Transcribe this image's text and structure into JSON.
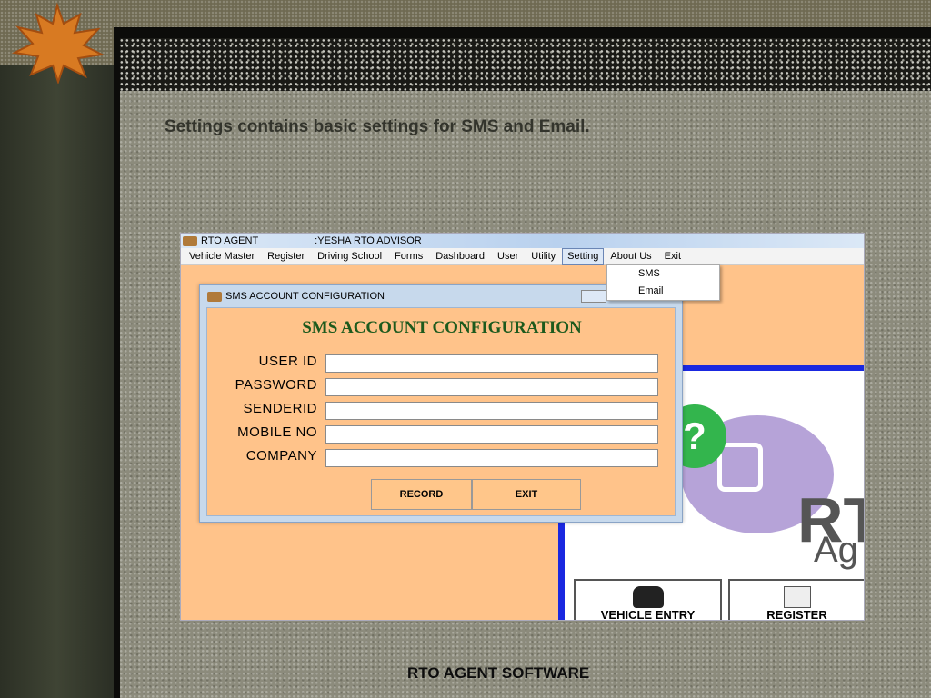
{
  "slide": {
    "heading": "Settings contains basic settings for SMS and Email.",
    "footer": "RTO  AGENT SOFTWARE"
  },
  "app": {
    "title": "RTO AGENT",
    "subtitle": ":YESHA RTO ADVISOR",
    "menu": [
      "Vehicle Master",
      "Register",
      "Driving School",
      "Forms",
      "Dashboard",
      "User",
      "Utility",
      "Setting",
      "About Us",
      "Exit"
    ],
    "active_menu": "Setting",
    "dropdown": [
      "SMS",
      "Email"
    ],
    "tiles": [
      "VEHICLE ENTRY",
      "REGISTER"
    ],
    "logo_rt": "RT",
    "logo_ag": "Ag"
  },
  "dialog": {
    "window_title": "SMS ACCOUNT CONFIGURATION",
    "heading": "SMS ACCOUNT CONFIGURATION",
    "fields": [
      {
        "label": "USER ID",
        "value": ""
      },
      {
        "label": "PASSWORD",
        "value": ""
      },
      {
        "label": "SENDERID",
        "value": ""
      },
      {
        "label": "MOBILE NO",
        "value": ""
      },
      {
        "label": "COMPANY",
        "value": ""
      }
    ],
    "record_label": "RECORD",
    "exit_label": "EXIT"
  },
  "colors": {
    "app_bg": "#ffc38a",
    "accent_blue": "#1a28e0",
    "heading_green": "#1d5a1d"
  }
}
